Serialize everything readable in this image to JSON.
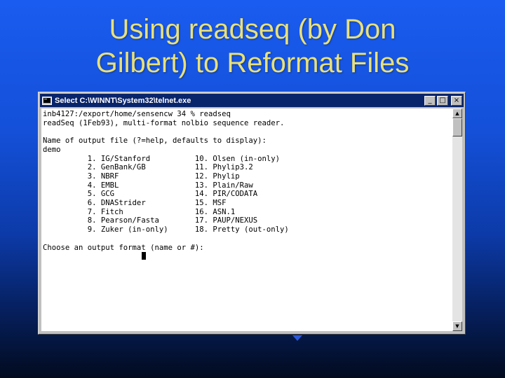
{
  "slide": {
    "title_line1": "Using readseq (by Don",
    "title_line2": "Gilbert) to Reformat Files"
  },
  "window": {
    "title": "Select C:\\WINNT\\System32\\telnet.exe",
    "icon": "terminal-icon",
    "controls": {
      "minimize": "_",
      "maximize": "□",
      "close": "×"
    }
  },
  "terminal": {
    "lines": [
      "inb4127:/export/home/sensencw 34 % readseq",
      "readSeq (1Feb93), multi-format nolbio sequence reader.",
      "",
      "Name of output file (?=help, defaults to display):",
      "demo",
      "          1. IG/Stanford          10. Olsen (in-only)",
      "          2. GenBank/GB           11. Phylip3.2",
      "          3. NBRF                 12. Phylip",
      "          4. EMBL                 13. Plain/Raw",
      "          5. GCG                  14. PIR/CODATA",
      "          6. DNAStrider           15. MSF",
      "          7. Fitch                16. ASN.1",
      "          8. Pearson/Fasta        17. PAUP/NEXUS",
      "          9. Zuker (in-only)      18. Pretty (out-only)",
      "",
      "Choose an output format (name or #):"
    ]
  }
}
